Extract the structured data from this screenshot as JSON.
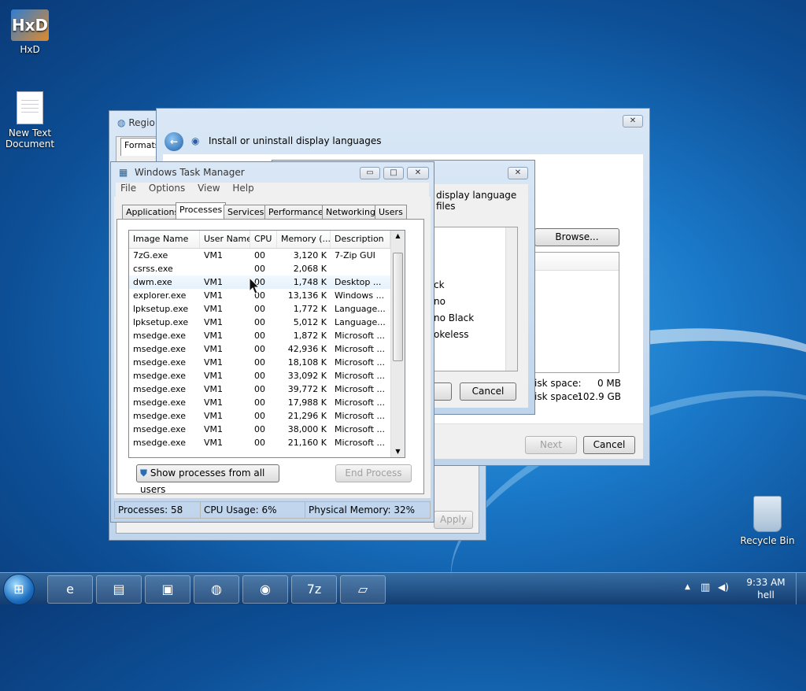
{
  "desktop": {
    "icons": [
      {
        "label": "HxD",
        "glyph": "HxD"
      },
      {
        "label": "New Text Document"
      },
      {
        "label": "Recycle Bin"
      }
    ]
  },
  "region_window": {
    "title": "Regio",
    "tab": "Formats",
    "apply_label": "Apply"
  },
  "install_window": {
    "title": "Install or uninstall display languages",
    "next_label": "Next",
    "cancel_label": "Cancel",
    "close_glyph": "✕",
    "back_glyph": "←",
    "browse_label": "Browse...",
    "disk_space_1_label": "isk space:",
    "disk_space_1_value": "0 MB",
    "disk_space_2_label": "isk space:",
    "disk_space_2_value": "102.9 GB"
  },
  "language_dialog": {
    "heading": "display language files",
    "close_glyph": "✕",
    "list_items": [
      "ck",
      "no",
      "no Black",
      "okeless"
    ],
    "cancel_label": "Cancel"
  },
  "task_manager": {
    "title": "Windows Task Manager",
    "min_glyph": "▭",
    "max_glyph": "□",
    "close_glyph": "✕",
    "menu": [
      "File",
      "Options",
      "View",
      "Help"
    ],
    "tabs": [
      "Applications",
      "Processes",
      "Services",
      "Performance",
      "Networking",
      "Users"
    ],
    "active_tab": "Processes",
    "columns": [
      "Image Name",
      "User Name",
      "CPU",
      "Memory (...",
      "Description"
    ],
    "rows": [
      [
        "7zG.exe",
        "VM1",
        "00",
        "3,120 K",
        "7-Zip GUI"
      ],
      [
        "csrss.exe",
        "",
        "00",
        "2,068 K",
        ""
      ],
      [
        "dwm.exe",
        "VM1",
        "00",
        "1,748 K",
        "Desktop ..."
      ],
      [
        "explorer.exe",
        "VM1",
        "00",
        "13,136 K",
        "Windows ..."
      ],
      [
        "lpksetup.exe",
        "VM1",
        "00",
        "1,772 K",
        "Language..."
      ],
      [
        "lpksetup.exe",
        "VM1",
        "00",
        "5,012 K",
        "Language..."
      ],
      [
        "msedge.exe",
        "VM1",
        "00",
        "1,872 K",
        "Microsoft ..."
      ],
      [
        "msedge.exe",
        "VM1",
        "00",
        "42,936 K",
        "Microsoft ..."
      ],
      [
        "msedge.exe",
        "VM1",
        "00",
        "18,108 K",
        "Microsoft ..."
      ],
      [
        "msedge.exe",
        "VM1",
        "00",
        "33,092 K",
        "Microsoft ..."
      ],
      [
        "msedge.exe",
        "VM1",
        "00",
        "39,772 K",
        "Microsoft ..."
      ],
      [
        "msedge.exe",
        "VM1",
        "00",
        "17,988 K",
        "Microsoft ..."
      ],
      [
        "msedge.exe",
        "VM1",
        "00",
        "21,296 K",
        "Microsoft ..."
      ],
      [
        "msedge.exe",
        "VM1",
        "00",
        "38,000 K",
        "Microsoft ..."
      ],
      [
        "msedge.exe",
        "VM1",
        "00",
        "21,160 K",
        "Microsoft ..."
      ]
    ],
    "show_all_label": "Show processes from all users",
    "end_process_label": "End Process",
    "status": {
      "processes": "Processes: 58",
      "cpu": "CPU Usage: 6%",
      "memory": "Physical Memory: 32%"
    }
  },
  "taskbar": {
    "buttons": [
      {
        "icon": "edge-icon",
        "glyph": "e"
      },
      {
        "icon": "folder-icon",
        "glyph": "▤"
      },
      {
        "icon": "monitor-icon",
        "glyph": "▣"
      },
      {
        "icon": "region-globe-icon",
        "glyph": "◍"
      },
      {
        "icon": "language-globe-icon",
        "glyph": "◉"
      },
      {
        "icon": "7zip-icon",
        "glyph": "7z"
      },
      {
        "icon": "notepad-icon",
        "glyph": "▱"
      }
    ],
    "tray_arrow": "▲",
    "network_glyph": "▥",
    "volume_glyph": "◀)",
    "time": "9:33 AM",
    "user": "hell"
  }
}
